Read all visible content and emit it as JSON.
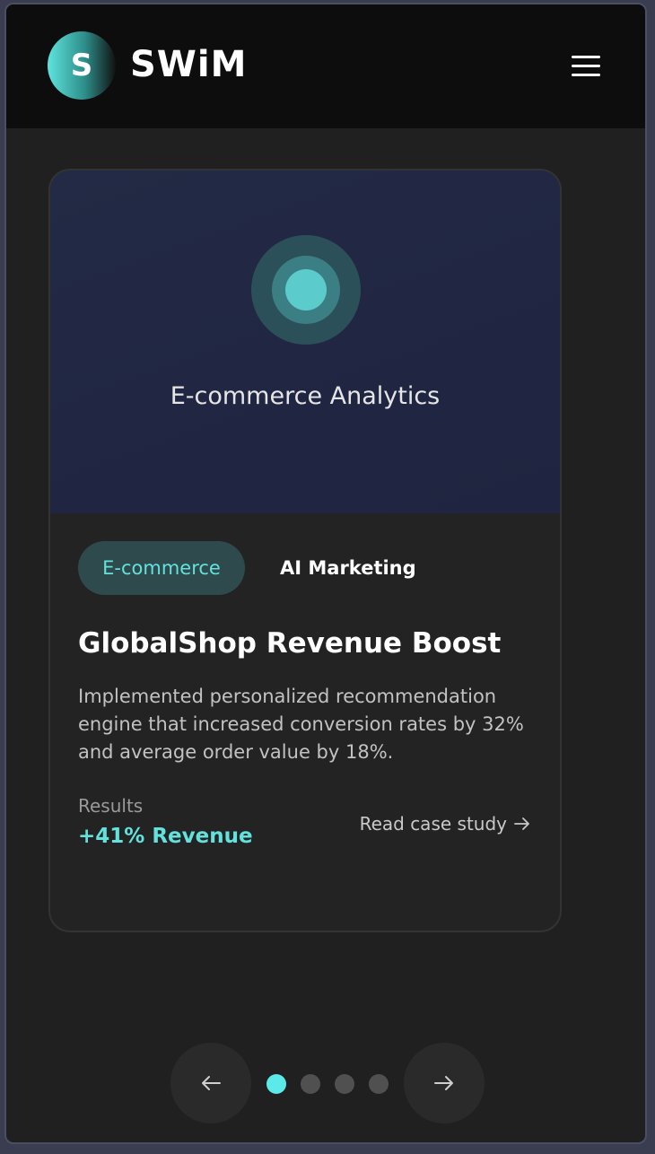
{
  "header": {
    "logo_letter": "S",
    "brand": "SWiM",
    "menu_icon": "hamburger-menu-icon"
  },
  "card": {
    "hero_title": "E-commerce Analytics",
    "hero_icon": "target-icon",
    "tags": [
      "E-commerce",
      "AI Marketing"
    ],
    "title": "GlobalShop Revenue Boost",
    "description": "Implemented personalized recommendation engine that increased conversion rates by 32% and average order value by 18%.",
    "results_label": "Results",
    "results_value": "+41% Revenue",
    "link_label": "Read case study",
    "link_icon": "arrow-right-icon"
  },
  "carousel": {
    "prev_icon": "arrow-left-icon",
    "next_icon": "arrow-right-icon",
    "total_slides": 4,
    "active_slide": 1
  },
  "colors": {
    "accent": "#63e2dd",
    "background": "#202020",
    "header": "#0d0d0d",
    "hero": "#232a45"
  }
}
